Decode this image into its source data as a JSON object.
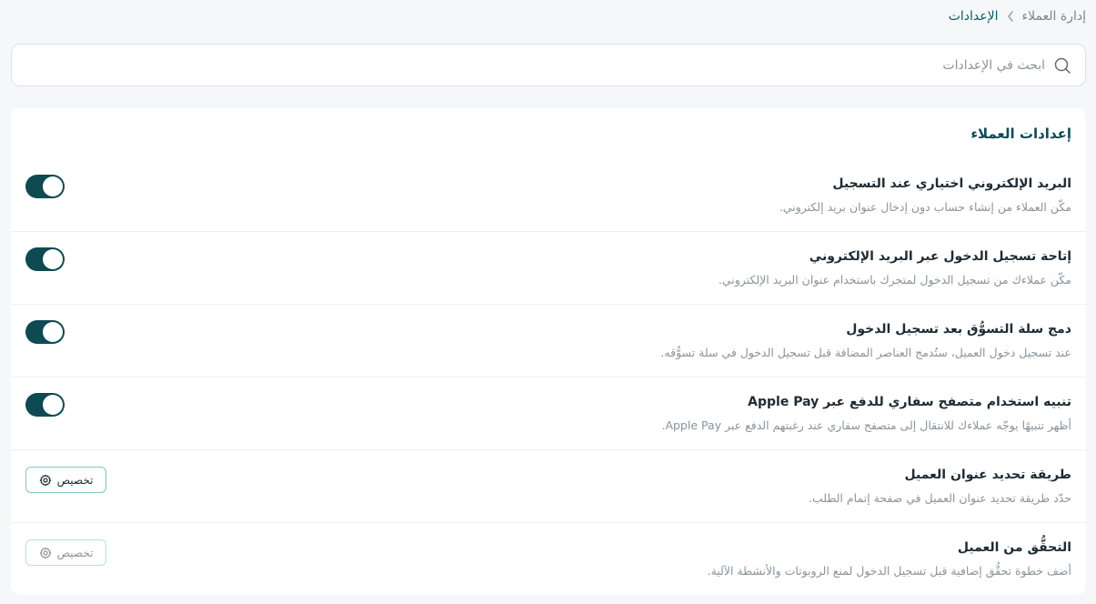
{
  "breadcrumb": {
    "parent": "إدارة العملاء",
    "current": "الإعدادات"
  },
  "search": {
    "placeholder": "ابحث في الإعدادات",
    "value": ""
  },
  "card": {
    "title": "إعدادات العملاء",
    "rows": [
      {
        "title": "البريد الإلكتروني اختياري عند التسجيل",
        "description": "مكّن العملاء من إنشاء حساب دون إدخال عنوان بريد إلكتروني.",
        "control": "toggle",
        "enabled": true
      },
      {
        "title": "إتاحة تسجيل الدخول عبر البريد الإلكتروني",
        "description": "مكّن عملاءك من تسجيل الدخول لمتجرك باستخدام عنوان البريد الإلكتروني.",
        "control": "toggle",
        "enabled": true
      },
      {
        "title": "دمج سلة التسوُّق بعد تسجيل الدخول",
        "description": "عند تسجيل دخول العميل، ستُدمج العناصر المضافة قبل تسجيل الدخول في سلة تسوُّقه.",
        "control": "toggle",
        "enabled": true
      },
      {
        "title": "تنبيه استخدام متصفح سفاري للدفع عبر Apple Pay",
        "description": "أظهر تنبيهًا يوجّه عملاءك للانتقال إلى متصفح سفاري عند رغبتهم الدفع عبر Apple Pay.",
        "control": "toggle",
        "enabled": true
      },
      {
        "title": "طريقة تحديد عنوان العميل",
        "description": "حدّد طريقة تحديد عنوان العميل في صفحة إتمام الطلب.",
        "control": "button",
        "button_label": "تخصيص",
        "button_state": "active"
      },
      {
        "title": "التحقُّق من العميل",
        "description": "أضف خطوة تحقُّق إضافية قبل تسجيل الدخول لمنع الروبوتات والأنشطة الآلية.",
        "control": "button",
        "button_label": "تخصيص",
        "button_state": "muted"
      }
    ]
  },
  "icons": {
    "search": "search-icon",
    "chevron": "chevron-left-icon",
    "gear": "gear-icon"
  },
  "colors": {
    "accent": "#0e4a52",
    "title": "#0f4a55",
    "button_border": "#7fc9c0"
  }
}
